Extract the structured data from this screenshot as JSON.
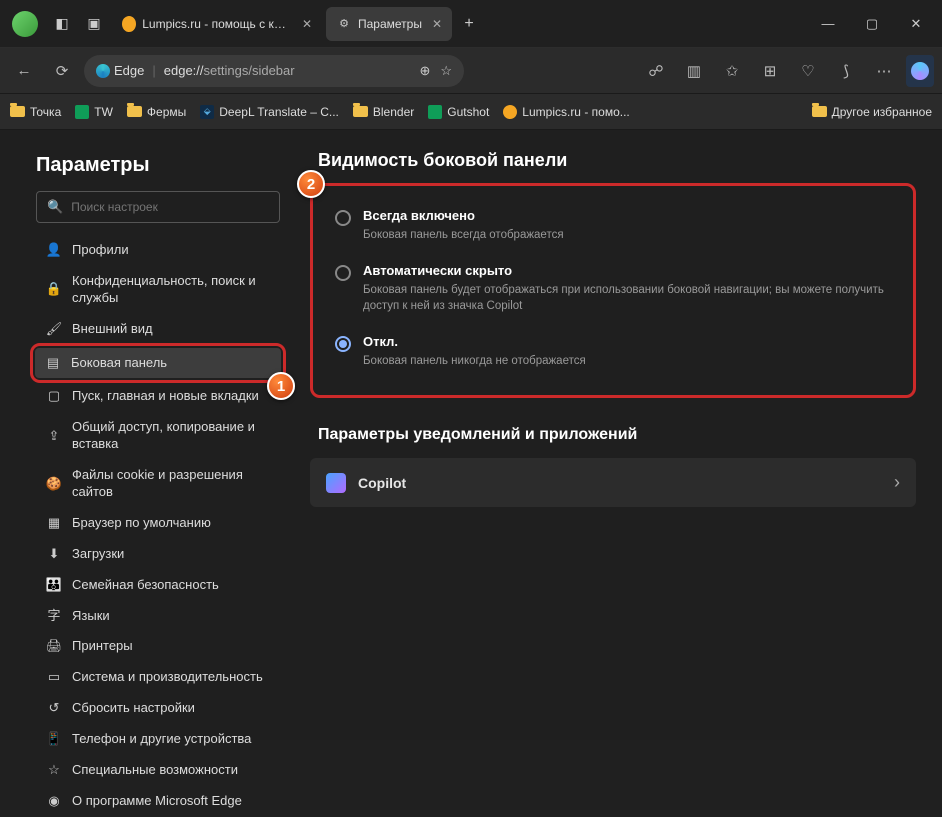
{
  "tabs": {
    "t1": {
      "label": "Lumpics.ru - помощь с компью"
    },
    "t2": {
      "label": "Параметры"
    }
  },
  "window": {
    "newtab": "+",
    "min": "—",
    "max": "▢",
    "close": "✕"
  },
  "toolbar": {
    "edge_label": "Edge",
    "url_protocol": "edge://",
    "url_path": "settings/sidebar"
  },
  "bookmarks": {
    "b1": "Точка",
    "b2": "TW",
    "b3": "Фермы",
    "b4": "DeepL Translate – С...",
    "b5": "Blender",
    "b6": "Gutshot",
    "b7": "Lumpics.ru - помо...",
    "other": "Другое избранное"
  },
  "sidebar": {
    "title": "Параметры",
    "search_placeholder": "Поиск настроек",
    "items": {
      "profiles": "Профили",
      "privacy": "Конфиденциальность, поиск и службы",
      "appearance": "Внешний вид",
      "sidebar": "Боковая панель",
      "start": "Пуск, главная и новые вкладки",
      "share": "Общий доступ, копирование и вставка",
      "cookies": "Файлы cookie и разрешения сайтов",
      "default": "Браузер по умолчанию",
      "downloads": "Загрузки",
      "family": "Семейная безопасность",
      "languages": "Языки",
      "printers": "Принтеры",
      "system": "Система и производительность",
      "reset": "Сбросить настройки",
      "phone": "Телефон и другие устройства",
      "accessibility": "Специальные возможности",
      "about": "О программе Microsoft Edge"
    }
  },
  "main": {
    "visibility_title": "Видимость боковой панели",
    "opt1_title": "Всегда включено",
    "opt1_desc": "Боковая панель всегда отображается",
    "opt2_title": "Автоматически скрыто",
    "opt2_desc": "Боковая панель будет отображаться при использовании боковой навигации; вы можете получить доступ к ней из значка Copilot",
    "opt3_title": "Откл.",
    "opt3_desc": "Боковая панель никогда не отображается",
    "notif_title": "Параметры уведомлений и приложений",
    "copilot": "Copilot"
  },
  "callouts": {
    "one": "1",
    "two": "2"
  }
}
